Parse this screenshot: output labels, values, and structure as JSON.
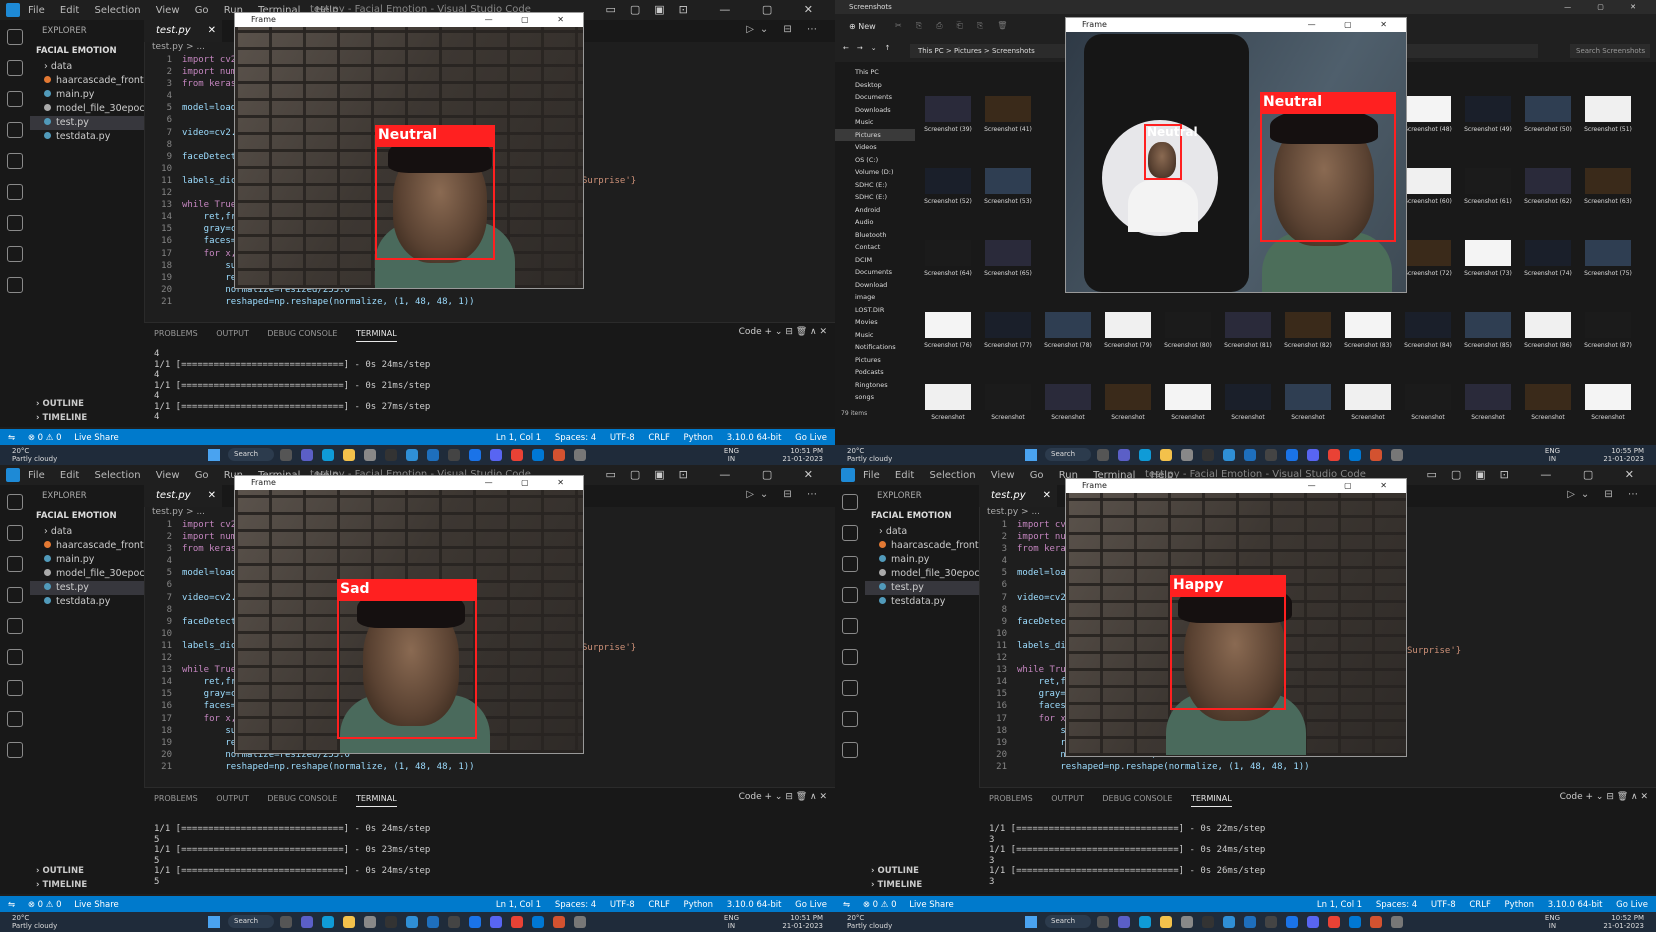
{
  "vscode": {
    "menu": [
      "File",
      "Edit",
      "Selection",
      "View",
      "Go",
      "Run",
      "Terminal",
      "Help"
    ],
    "window_title": "test.py - Facial Emotion - Visual Studio Code",
    "explorer_header": "EXPLORER",
    "project": "FACIAL EMOTION",
    "files": [
      "data",
      "haarcascade_frontalfa...",
      "main.py",
      "model_file_30epochs...",
      "test.py",
      "testdata.py"
    ],
    "outline": "OUTLINE",
    "timeline": "TIMELINE",
    "tab": "test.py",
    "breadcrumb": "test.py > ...",
    "code": [
      {
        "n": "1",
        "t": "import cv2"
      },
      {
        "n": "2",
        "t": "import num"
      },
      {
        "n": "3",
        "t": "from keras"
      },
      {
        "n": "4",
        "t": ""
      },
      {
        "n": "5",
        "t": "model=load"
      },
      {
        "n": "6",
        "t": ""
      },
      {
        "n": "7",
        "t": "video=cv2."
      },
      {
        "n": "8",
        "t": ""
      },
      {
        "n": "9",
        "t": "faceDetect"
      },
      {
        "n": "10",
        "t": ""
      },
      {
        "n": "11",
        "t": "labels_dic"
      },
      {
        "n": "12",
        "t": ""
      },
      {
        "n": "13",
        "t": "while True"
      },
      {
        "n": "14",
        "t": "    ret,fr"
      },
      {
        "n": "15",
        "t": "    gray=c"
      },
      {
        "n": "16",
        "t": "    faces="
      },
      {
        "n": "17",
        "t": "    for x,"
      },
      {
        "n": "18",
        "t": "        su"
      },
      {
        "n": "19",
        "t": "        re"
      },
      {
        "n": "20",
        "t": "        normalize=resized/255.0"
      },
      {
        "n": "21",
        "t": "        reshaped=np.reshape(normalize, (1, 48, 48, 1))"
      }
    ],
    "code_tail": "Surprise'}",
    "panel_tabs": [
      "PROBLEMS",
      "OUTPUT",
      "DEBUG CONSOLE",
      "TERMINAL"
    ],
    "panel_tools": "Code  +  ⌄  ⊟  🗑  ∧  ✕",
    "status": {
      "remote": "⇋",
      "errors": "⊗ 0 ⚠ 0",
      "live_share": "Live Share",
      "position": "Ln 1, Col 1",
      "spaces": "Spaces: 4",
      "encoding": "UTF-8",
      "eol": "CRLF",
      "lang": "Python",
      "interpreter": "3.10.0 64-bit",
      "go_live": "Go Live"
    }
  },
  "frame_title": "Frame",
  "taskbar": {
    "temp": "20°C",
    "weather": "Partly cloudy",
    "search": "Search",
    "lang1": "ENG",
    "lang2": "IN",
    "date": "21-01-2023"
  },
  "quadrants": {
    "top_left": {
      "terminal": [
        "4",
        "1/1 [==============================] - 0s 24ms/step",
        "4",
        "1/1 [==============================] - 0s 21ms/step",
        "4",
        "1/1 [==============================] - 0s 27ms/step",
        "4"
      ],
      "label": "Neutral",
      "time": "10:51 PM"
    },
    "bottom_left": {
      "terminal": [
        "1/1 [==============================] - 0s 24ms/step",
        "5",
        "1/1 [==============================] - 0s 23ms/step",
        "5",
        "1/1 [==============================] - 0s 24ms/step",
        "5"
      ],
      "label": "Sad",
      "time": "10:51 PM"
    },
    "bottom_right": {
      "terminal": [
        "1/1 [==============================] - 0s 22ms/step",
        "3",
        "1/1 [==============================] - 0s 24ms/step",
        "3",
        "1/1 [==============================] - 0s 26ms/step",
        "3"
      ],
      "label": "Happy",
      "time": "10:52 PM"
    },
    "top_right": {
      "explorer_title": "Screenshots",
      "new_button": "New",
      "address": "This PC  >  Pictures  >  Screenshots",
      "search_placeholder": "Search Screenshots",
      "nav": [
        "This PC",
        "Desktop",
        "Documents",
        "Downloads",
        "Music",
        "Pictures",
        "Videos",
        "OS (C:)",
        "Volume (D:)",
        "SDHC (E:)",
        "SDHC (E:)",
        "Android",
        "Audio",
        "Bluetooth",
        "Contact",
        "DCIM",
        "Documents",
        "Download",
        "image",
        "LOST.DIR",
        "Movies",
        "Music",
        "Notifications",
        "Pictures",
        "Podcasts",
        "Ringtones",
        "songs"
      ],
      "item_count": "79 items",
      "thumb_rows": [
        [
          "Screenshot (39)",
          "Screenshot (41)",
          "Screenshot (48)",
          "Screenshot (49)",
          "Screenshot (50)",
          "Screenshot (51)"
        ],
        [
          "Screenshot (52)",
          "Screenshot (53)",
          "Screenshot (60)",
          "Screenshot (61)",
          "Screenshot (62)",
          "Screenshot (63)"
        ],
        [
          "Screenshot (64)",
          "Screenshot (65)",
          "Screenshot (72)",
          "Screenshot (73)",
          "Screenshot (74)",
          "Screenshot (75)"
        ],
        [
          "Screenshot (76)",
          "Screenshot (77)",
          "Screenshot (78)",
          "Screenshot (79)",
          "Screenshot (80)",
          "Screenshot (81)",
          "Screenshot (82)",
          "Screenshot (83)",
          "Screenshot (84)",
          "Screenshot (85)",
          "Screenshot (86)",
          "Screenshot (87)"
        ],
        [
          "Screenshot",
          "Screenshot",
          "Screenshot",
          "Screenshot",
          "Screenshot",
          "Screenshot",
          "Screenshot",
          "Screenshot",
          "Screenshot",
          "Screenshot",
          "Screenshot",
          "Screenshot"
        ]
      ],
      "label_big": "Neutral",
      "label_small": "Neutral",
      "time": "10:55 PM"
    }
  }
}
